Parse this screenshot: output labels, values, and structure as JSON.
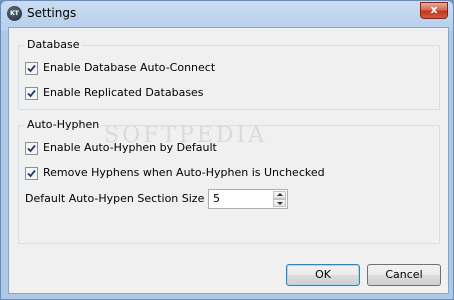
{
  "window": {
    "title": "Settings",
    "close_glyph": "x",
    "app_icon_text": "KT"
  },
  "database": {
    "legend": "Database",
    "auto_connect": {
      "label": "Enable Database Auto-Connect",
      "checked": true
    },
    "replicated": {
      "label": "Enable Replicated Databases",
      "checked": true
    }
  },
  "auto_hyphen": {
    "legend": "Auto-Hyphen",
    "enable": {
      "label": "Enable Auto-Hyphen by Default",
      "checked": true
    },
    "remove": {
      "label": "Remove Hyphens when Auto-Hyphen is Unchecked",
      "checked": true
    },
    "section_size": {
      "label": "Default Auto-Hypen Section Size",
      "value": "5"
    }
  },
  "buttons": {
    "ok": "OK",
    "cancel": "Cancel"
  },
  "watermark": "SOFTPEDIA"
}
